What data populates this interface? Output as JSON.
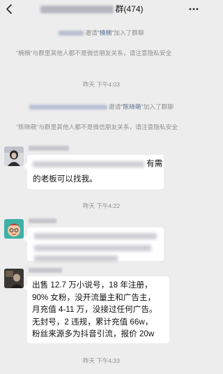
{
  "header": {
    "title_suffix": "群(474)",
    "back_icon": "back-chevron-icon",
    "more_icon": "more-dots-icon"
  },
  "notices": {
    "invite_1": {
      "verb": "邀请",
      "quoted_name": "\"楠楠\"",
      "suffix": "加入了群聊"
    },
    "privacy_1": {
      "text": "\"楠楠\"与群里其他人都不是微信朋友关系，请注意隐私安全"
    },
    "time_1": "昨天 下午4:03",
    "invite_2": {
      "verb": "邀请",
      "quoted_name": "\"陈晓萌\"",
      "suffix": "加入了群聊"
    },
    "privacy_2": {
      "text": "\"陈晓萌\"与群里其他人都不是微信朋友关系，请注意隐私安全"
    },
    "time_2": "昨天 下午4:22",
    "time_3": "昨天 下午4:33"
  },
  "messages": [
    {
      "avatar": "dark-photo-avatar",
      "partial_text": "有需",
      "text": "的老板可以找我。"
    },
    {
      "avatar": "cartoon-boy-avatar"
    },
    {
      "avatar": "dark-room-avatar",
      "text": "出售 12.7 万小说号，18 年注册，\n90% 女粉，没开流量主和广告主，\n月充值 4-11 万，没接过任何广告。\n无封号，2 违规，累计充值 66w，\n粉丝来源多为抖音引流，报价 20w"
    }
  ],
  "colors": {
    "background": "#ededed",
    "bubble": "#ffffff",
    "notice_text": "#8f8f8f",
    "name_link": "#5a6f92"
  }
}
